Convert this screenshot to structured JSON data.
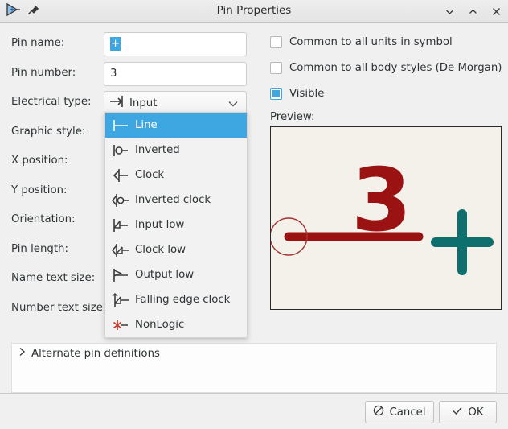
{
  "window": {
    "title": "Pin Properties",
    "app_icon": "pin-symbol-icon",
    "pin_icon": "thumbtack-icon",
    "controls": {
      "minimize": "chevron-down-icon",
      "maximize": "chevron-up-icon",
      "close": "close-icon"
    }
  },
  "form": {
    "rows": [
      {
        "label": "Pin name:",
        "value": "+",
        "kind": "text-selected"
      },
      {
        "label": "Pin number:",
        "value": "3",
        "kind": "text"
      },
      {
        "label": "Electrical type:",
        "value": "Input",
        "kind": "combo"
      },
      {
        "label": "Graphic style:",
        "value": "",
        "kind": "combo-open"
      },
      {
        "label": "X position:",
        "value": "",
        "kind": "text"
      },
      {
        "label": "Y position:",
        "value": "",
        "kind": "text"
      },
      {
        "label": "Orientation:",
        "value": "",
        "kind": "combo"
      },
      {
        "label": "Pin length:",
        "value": "",
        "kind": "text"
      },
      {
        "label": "Name text size:",
        "value": "",
        "kind": "text"
      },
      {
        "label": "Number text size:",
        "value": "",
        "kind": "text"
      }
    ]
  },
  "graphic_style_dropdown": {
    "open": true,
    "selected_index": 0,
    "items": [
      {
        "label": "Line",
        "icon": "pin-line-icon"
      },
      {
        "label": "Inverted",
        "icon": "pin-inverted-icon"
      },
      {
        "label": "Clock",
        "icon": "pin-clock-icon"
      },
      {
        "label": "Inverted clock",
        "icon": "pin-inverted-clock-icon"
      },
      {
        "label": "Input low",
        "icon": "pin-input-low-icon"
      },
      {
        "label": "Clock low",
        "icon": "pin-clock-low-icon"
      },
      {
        "label": "Output low",
        "icon": "pin-output-low-icon"
      },
      {
        "label": "Falling edge clock",
        "icon": "pin-falling-edge-clock-icon"
      },
      {
        "label": "NonLogic",
        "icon": "pin-nonlogic-icon"
      }
    ]
  },
  "options": {
    "common_units": {
      "label": "Common to all units in symbol",
      "checked": false
    },
    "common_body": {
      "label": "Common to all body styles (De Morgan)",
      "checked": false
    },
    "visible": {
      "label": "Visible",
      "checked": true
    }
  },
  "preview": {
    "label": "Preview:",
    "pin_number": "3",
    "background": "#f3f1ea",
    "pin_color": "#9b1212",
    "anchor_color": "#a53232",
    "cursor_color": "#0e6f6f"
  },
  "alternate": {
    "header": "Alternate pin definitions",
    "chevron": "chevron-right-icon"
  },
  "buttons": {
    "cancel": {
      "label": "Cancel",
      "icon": "no-entry-icon"
    },
    "ok": {
      "label": "OK",
      "icon": "checkmark-icon"
    }
  },
  "colors": {
    "accent": "#3ea6e0",
    "dialog_bg": "#f0f0f0",
    "field_bg": "#ffffff"
  }
}
